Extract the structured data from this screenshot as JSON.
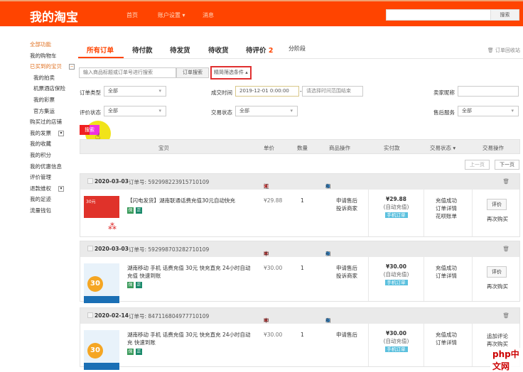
{
  "header": {
    "logo": "我的淘宝",
    "nav": [
      "首页",
      "账户设置 ▾",
      "消息"
    ],
    "search_button": "搜索",
    "search_value": ""
  },
  "sidebar": {
    "title": "全部功能",
    "items": [
      {
        "label": "我的购物车",
        "cls": ""
      },
      {
        "label": "已买到的宝贝",
        "cls": "or",
        "toggle": "−"
      },
      {
        "label": "我的拍卖",
        "cls": "sub"
      },
      {
        "label": "机票酒店保险",
        "cls": "sub"
      },
      {
        "label": "我的彩票",
        "cls": "sub"
      },
      {
        "label": "官方集运",
        "cls": "sub"
      },
      {
        "label": "购买过的店铺",
        "cls": ""
      },
      {
        "label": "我的发票",
        "cls": "",
        "toggle": "▾"
      },
      {
        "label": "我的收藏",
        "cls": ""
      },
      {
        "label": "我的积分",
        "cls": ""
      },
      {
        "label": "我的优惠信息",
        "cls": ""
      },
      {
        "label": "评价管理",
        "cls": ""
      },
      {
        "label": "退款维权",
        "cls": "",
        "toggle": "▾"
      },
      {
        "label": "我的足迹",
        "cls": ""
      },
      {
        "label": "流量钱包",
        "cls": ""
      }
    ]
  },
  "tabs": [
    "所有订单",
    "待付款",
    "待发货",
    "待收货",
    "待评价",
    "分阶段"
  ],
  "tab_badge": "2",
  "recycle": "订单回收站",
  "search": {
    "placeholder": "输入商品标题或订单号进行搜索",
    "button": "订单搜索",
    "simple": "精简筛选条件 ▴"
  },
  "filters": {
    "order_type_label": "订单类型",
    "order_type": "全部",
    "time_label": "成交时间",
    "time_start": "2019-12-01 0:00:00",
    "time_end_placeholder": "请选择时间范围结束",
    "seller_label": "卖家昵称",
    "rate_label": "评价状态",
    "rate": "全部",
    "trade_label": "交易状态",
    "trade": "全部",
    "after_label": "售后服务",
    "after": "全部",
    "search_btn": "搜索"
  },
  "table_header": [
    "宝贝",
    "单价",
    "数量",
    "商品操作",
    "实付款",
    "交易状态 ▾",
    "交易操作"
  ],
  "pagination": {
    "prev": "上一页",
    "next": "下一页"
  },
  "orders": [
    {
      "date": "2020-03-03",
      "order_no": "订单号: 592998223915710109",
      "shop": "江山话费充...",
      "contact": "和我联系",
      "title": "【闪电发货】湖南联通话费充值30元自动快充",
      "price": "¥29.88",
      "qty": "1",
      "ops": [
        "申请售后",
        "投诉商家"
      ],
      "paid": "¥29.88",
      "paid_note": "(自动充值)",
      "paid_tag": "手机订单",
      "status": [
        "充值成功",
        "订单详情",
        "花呗账单"
      ],
      "actions": [
        "评价",
        "再次购买"
      ]
    },
    {
      "date": "2020-03-03",
      "order_no": "订单号: 592998703282710109",
      "shop": "中国移动和...",
      "contact": "和我联系",
      "title": "湖南移动 手机 话费充值 30元 快充直充 24小时自动充值 快速到账",
      "price": "¥30.00",
      "qty": "1",
      "ops": [
        "申请售后",
        "投诉商家"
      ],
      "paid": "¥30.00",
      "paid_note": "(自动充值)",
      "paid_tag": "手机订单",
      "status": [
        "充值成功",
        "订单详情"
      ],
      "actions": [
        "评价",
        "再次购买"
      ]
    },
    {
      "date": "2020-02-14",
      "order_no": "订单号: 847116804977710109",
      "shop": "中国移动官",
      "contact": "和我联系",
      "title": "湖南移动 手机 话费充值 30元 快充直充 24小时自动充 快速到账",
      "price": "¥30.00",
      "qty": "1",
      "ops": [
        "申请售后"
      ],
      "paid": "¥30.00",
      "paid_note": "(自动充值)",
      "paid_tag": "手机订单",
      "status": [
        "充值成功",
        "订单详情"
      ],
      "actions": [
        "追加评论",
        "再次购买"
      ]
    }
  ],
  "watermark": "php中文网"
}
